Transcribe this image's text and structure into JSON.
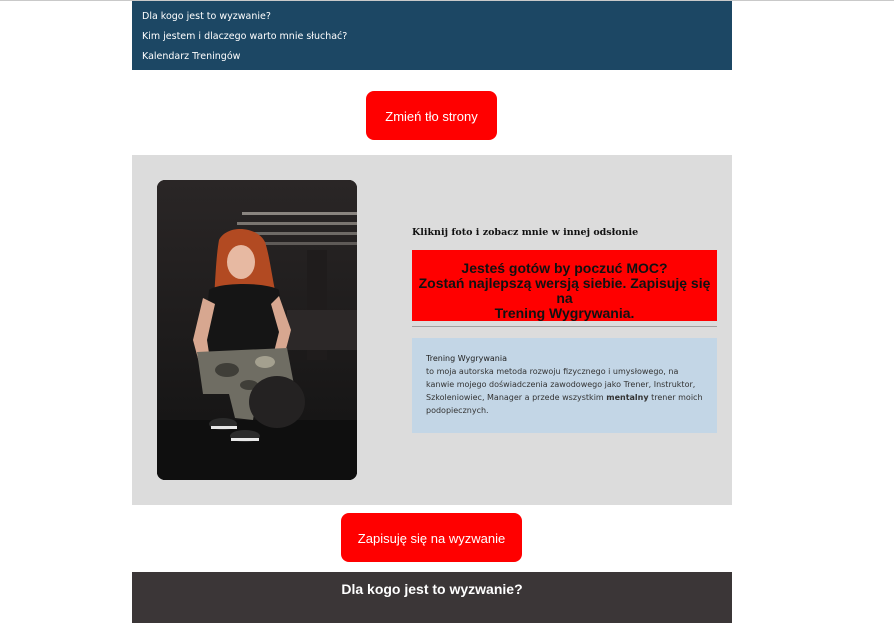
{
  "nav": {
    "items": [
      {
        "label": "Dla kogo jest to wyzwanie?"
      },
      {
        "label": "Kim jestem i dlaczego warto mnie słuchać?"
      },
      {
        "label": "Kalendarz Treningów"
      }
    ]
  },
  "change_bg_button": {
    "label": "Zmień tło strony"
  },
  "hero": {
    "photo_icon": "trainer-photo",
    "click_note": "Kliknij foto i zobacz mnie w innej odsłonie",
    "callout": {
      "line1": "Jesteś gotów by poczuć MOC?",
      "line2": "Zostań najlepszą wersją siebie. Zapisuję się na",
      "line3": "Trening Wygrywania."
    },
    "info": {
      "title": "Trening Wygrywania",
      "text1": "to moja autorska metoda rozwoju fizycznego i umysłowego, na kanwie mojego doświadczenia zawodowego jako Trener, Instruktor, Szkoleniowiec, Manager a przede wszystkim ",
      "strong": "mentalny",
      "text2": " trener moich podopiecznych."
    }
  },
  "signup_button": {
    "label": "Zapisuję się na wyzwanie"
  },
  "footer": {
    "title": "Dla kogo jest to wyzwanie?"
  },
  "colors": {
    "nav_bg": "#1c4764",
    "accent_red": "#ff0000",
    "hero_bg": "#dcdcdc",
    "info_bg": "#c3d6e6",
    "footer_bg": "#3b3637"
  }
}
